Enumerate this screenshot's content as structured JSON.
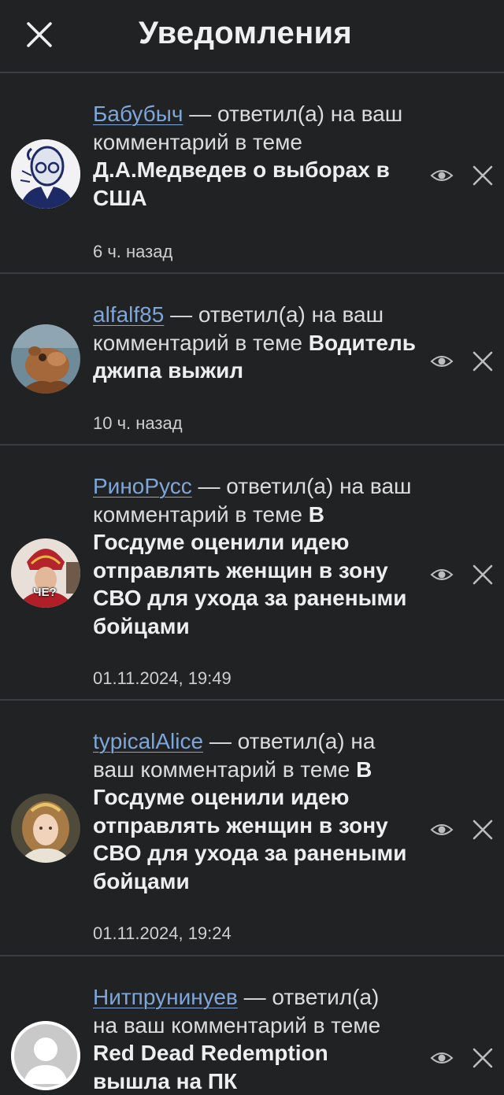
{
  "header": {
    "title": "Уведомления"
  },
  "icons": {
    "close": "close-icon",
    "eye": "eye-icon",
    "dismiss": "dismiss-icon"
  },
  "colors": {
    "background": "#212224",
    "divider": "#3b3c3f",
    "link": "#7ea6d9",
    "text": "#dcdcdc"
  },
  "notifications": [
    {
      "user": "Бабубыч",
      "action": " — ответил(а) на ваш комментарий в теме ",
      "topic": "Д.А.Медведев о выборах в США",
      "time": "6 ч. назад"
    },
    {
      "user": "alfalf85",
      "action": " — ответил(а) на ваш комментарий в теме ",
      "topic": "Водитель джипа выжил",
      "time": "10 ч. назад"
    },
    {
      "user": "РиноРусс",
      "action": " — ответил(а) на ваш комментарий в теме ",
      "topic": "В Госдуме оценили идею отправлять женщин в зону СВО для ухода за ранеными бойцами",
      "time": "01.11.2024, 19:49",
      "avatar_caption": "ЧЕ?"
    },
    {
      "user": "typicalAlice",
      "action": " — ответил(а) на ваш комментарий в теме ",
      "topic": "В Госдуме оценили идею отправлять женщин в зону СВО для ухода за ранеными бойцами",
      "time": "01.11.2024, 19:24"
    },
    {
      "user": "Нитпрунинуев",
      "action": " — ответил(а) на ваш комментарий в теме ",
      "topic": "Red Dead Redemption вышла на ПК",
      "time": ""
    }
  ]
}
